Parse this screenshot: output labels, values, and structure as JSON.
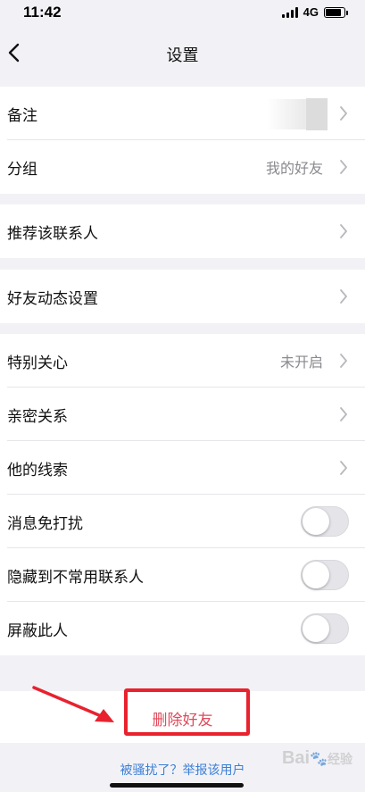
{
  "status_bar": {
    "time": "11:42",
    "network": "4G"
  },
  "nav": {
    "title": "设置"
  },
  "groups": {
    "profile": [
      {
        "label": "备注",
        "value": ""
      },
      {
        "label": "分组",
        "value": "我的好友"
      }
    ],
    "recommend": [
      {
        "label": "推荐该联系人"
      }
    ],
    "moments": [
      {
        "label": "好友动态设置"
      }
    ],
    "relations": [
      {
        "label": "特别关心",
        "value": "未开启"
      },
      {
        "label": "亲密关系"
      },
      {
        "label": "他的线索"
      },
      {
        "label": "消息免打扰",
        "toggle": false
      },
      {
        "label": "隐藏到不常用联系人",
        "toggle": false
      },
      {
        "label": "屏蔽此人",
        "toggle": false
      }
    ]
  },
  "actions": {
    "delete_label": "删除好友",
    "report_link": "被骚扰了？举报该用户"
  },
  "colors": {
    "delete": "#e04a5a",
    "highlight": "#e8222e",
    "link": "#3b7fd6"
  }
}
